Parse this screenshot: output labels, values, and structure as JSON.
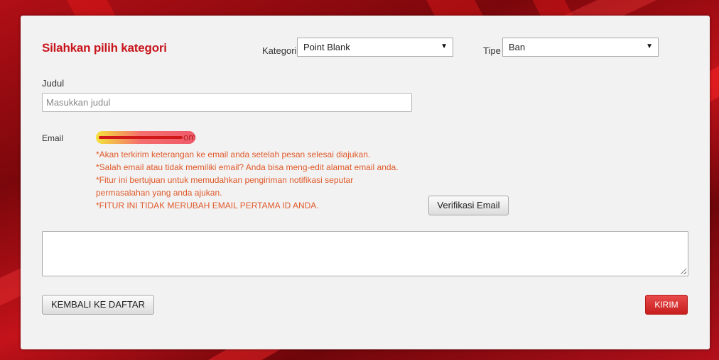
{
  "form": {
    "heading": "Silahkan pilih kategori",
    "kategori": {
      "label": "Kategori",
      "selected": "Point Blank"
    },
    "tipe": {
      "label": "Tipe",
      "selected": "Ban"
    },
    "judul": {
      "label": "Judul",
      "placeholder": "Masukkan judul"
    },
    "email": {
      "label": "Email",
      "value_visible_fragment": "om",
      "notes": [
        "*Akan terkirim keterangan ke email anda setelah pesan selesai diajukan.",
        "*Salah email atau tidak memiliki email? Anda bisa meng-edit alamat email anda.",
        "*Fitur ini bertujuan untuk memudahkan pengiriman notifikasi seputar permasalahan yang anda ajukan.",
        "*FITUR INI TIDAK MERUBAH EMAIL PERTAMA ID ANDA."
      ],
      "verify_button": "Verifikasi Email"
    },
    "back_button": "KEMBALI KE DAFTAR",
    "submit_button": "KIRIM"
  },
  "icons": {
    "dropdown": "chevron-down-icon",
    "resize": "resize-handle-icon"
  },
  "colors": {
    "accent": "#c8161d",
    "notes": "#e05a2b",
    "background": "#8a0a0f"
  }
}
